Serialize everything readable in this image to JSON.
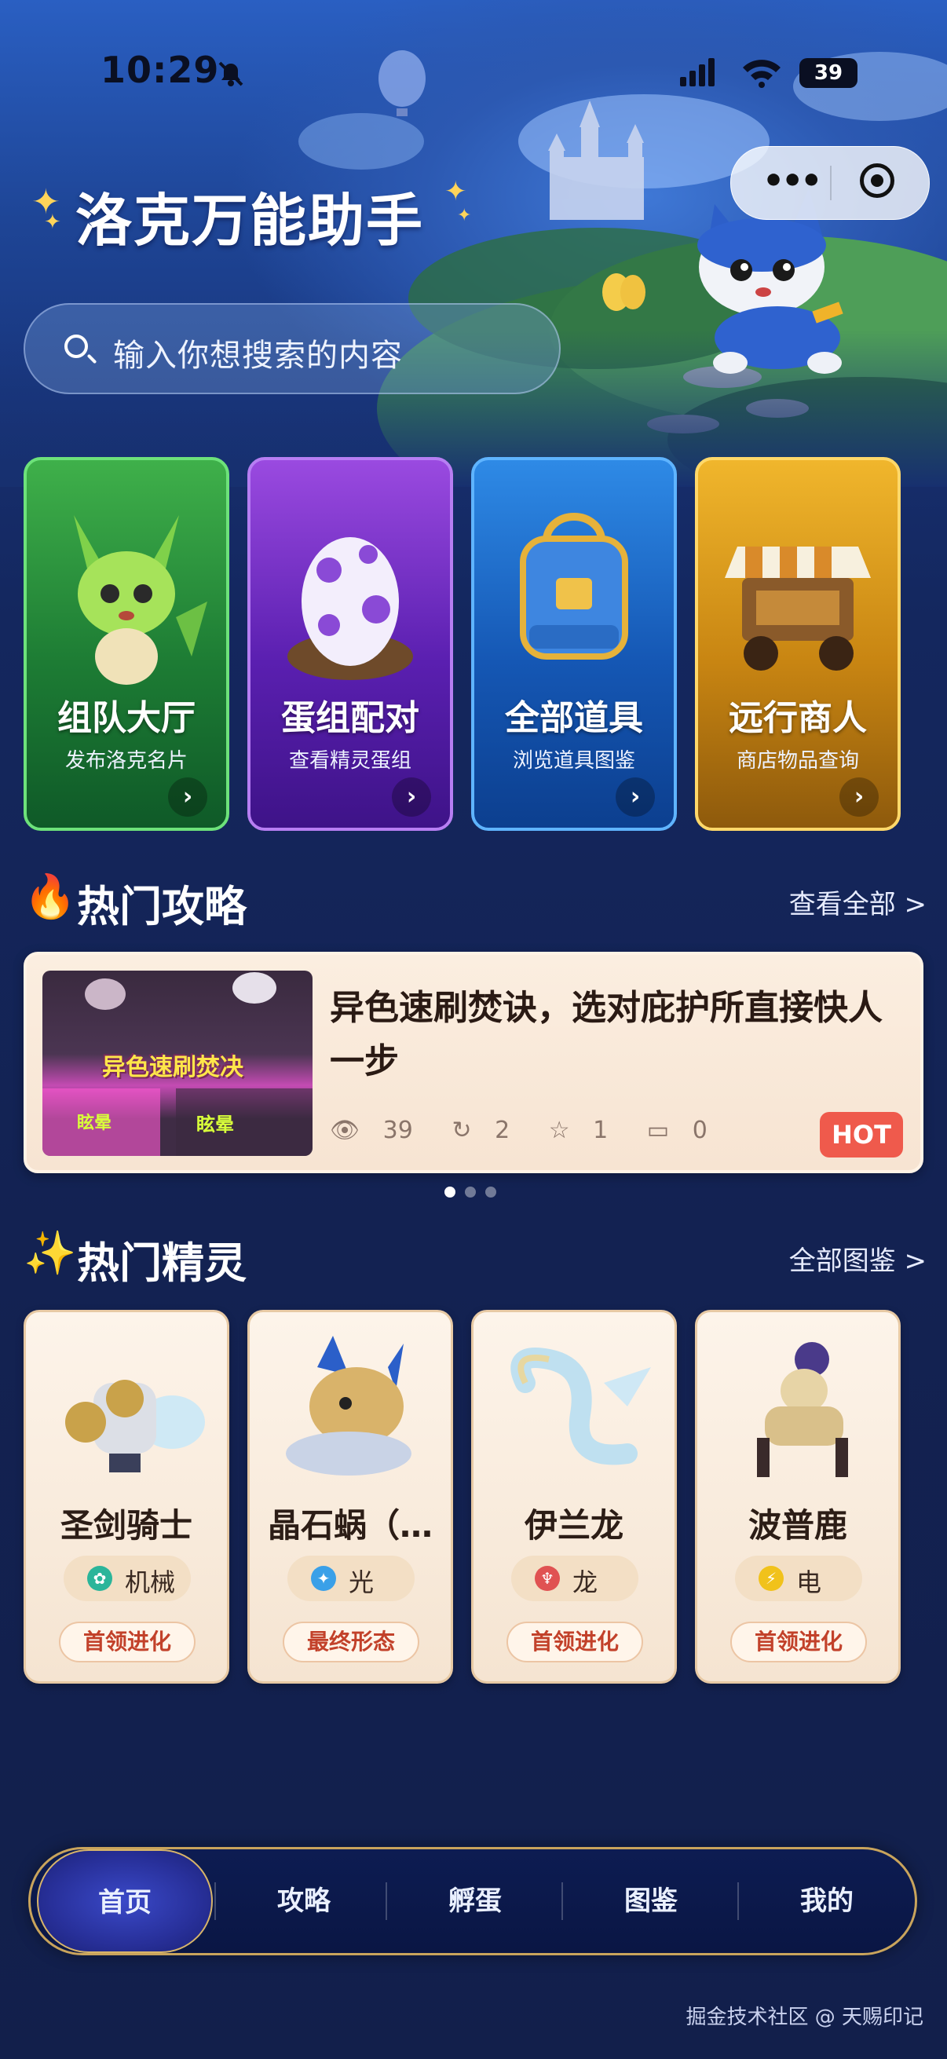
{
  "status": {
    "time": "10:29",
    "battery": "39"
  },
  "app": {
    "title": "洛克万能助手"
  },
  "search": {
    "placeholder": "输入你想搜索的内容"
  },
  "features": [
    {
      "title": "组队大厅",
      "subtitle": "发布洛克名片",
      "arrow": "›"
    },
    {
      "title": "蛋组配对",
      "subtitle": "查看精灵蛋组",
      "arrow": "›"
    },
    {
      "title": "全部道具",
      "subtitle": "浏览道具图鉴",
      "arrow": "›"
    },
    {
      "title": "远行商人",
      "subtitle": "商店物品查询",
      "arrow": "›"
    }
  ],
  "guides": {
    "icon": "🔥",
    "title": "热门攻略",
    "link": "查看全部 >",
    "item": {
      "thumb_text": "异色速刷焚决",
      "thumb_tag1": "眩晕",
      "thumb_tag2": "眩晕",
      "title": "异色速刷焚诀，选对庇护所直接快人一步",
      "views": "39",
      "shares": "2",
      "stars": "1",
      "comments": "0",
      "badge": "HOT"
    }
  },
  "pets_section": {
    "icon": "✨",
    "title": "热门精灵",
    "link": "全部图鉴 >"
  },
  "pets": [
    {
      "name": "圣剑骑士",
      "type": "机械",
      "stage": "首领进化",
      "type_color": "#2bb59a"
    },
    {
      "name": "晶石蜗（…",
      "type": "光",
      "stage": "最终形态",
      "type_color": "#3aa0e8"
    },
    {
      "name": "伊兰龙",
      "type": "龙",
      "stage": "首领进化",
      "type_color": "#e05252"
    },
    {
      "name": "波普鹿",
      "type": "电",
      "stage": "首领进化",
      "type_color": "#f1c21b"
    }
  ],
  "tabs": [
    "首页",
    "攻略",
    "孵蛋",
    "图鉴",
    "我的"
  ],
  "watermark": "掘金技术社区 @ 天赐印记"
}
